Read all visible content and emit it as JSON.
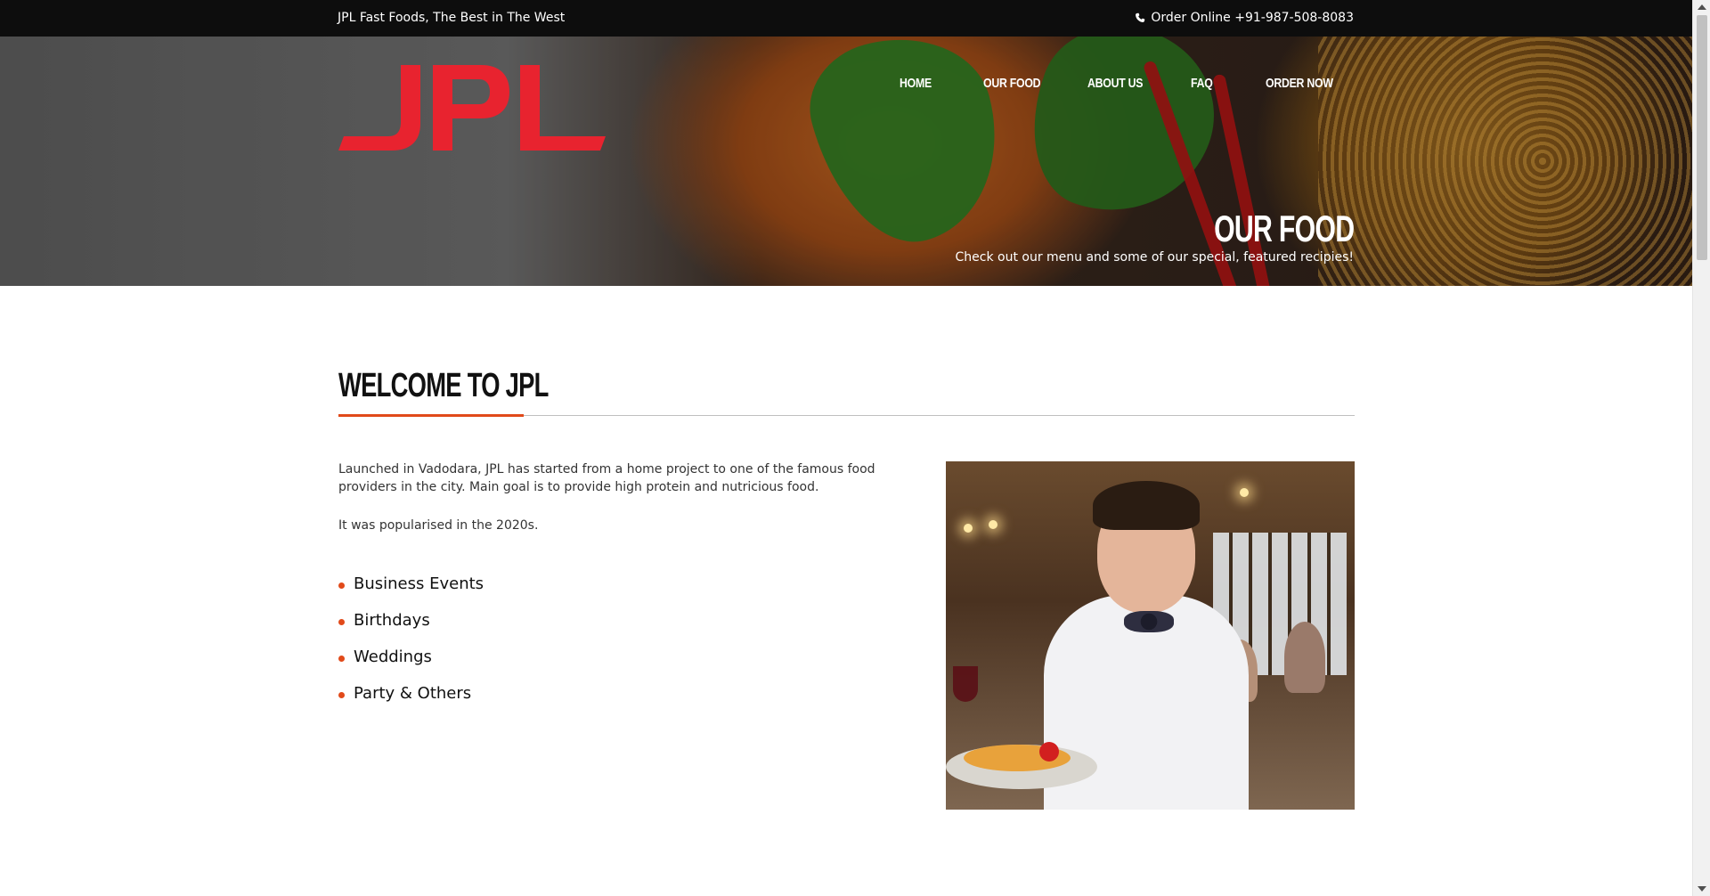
{
  "topbar": {
    "tagline": "JPL Fast Foods, The Best in The West",
    "order_text": "Order Online +91-987-508-8083",
    "phone_icon": "phone-icon"
  },
  "logo": {
    "text": "JPL",
    "color": "#e8232f"
  },
  "nav": {
    "items": [
      {
        "label": "HOME"
      },
      {
        "label": "OUR FOOD"
      },
      {
        "label": "ABOUT US"
      },
      {
        "label": "FAQ"
      },
      {
        "label": "ORDER NOW"
      }
    ]
  },
  "hero": {
    "title": "OUR FOOD",
    "subtitle": "Check out our menu and some of our special, featured recipies!"
  },
  "welcome": {
    "title": "WELCOME TO JPL",
    "paragraph1": "Launched in Vadodara, JPL has started from a home project to one of the famous food providers in the city. Main goal is to provide high protein and nutricious food.",
    "paragraph2": "It was popularised in the 2020s.",
    "list": [
      "Business Events",
      "Birthdays",
      "Weddings",
      "Party & Others"
    ]
  },
  "colors": {
    "accent": "#e14a1a",
    "topbar_bg": "#0d0d0d"
  }
}
